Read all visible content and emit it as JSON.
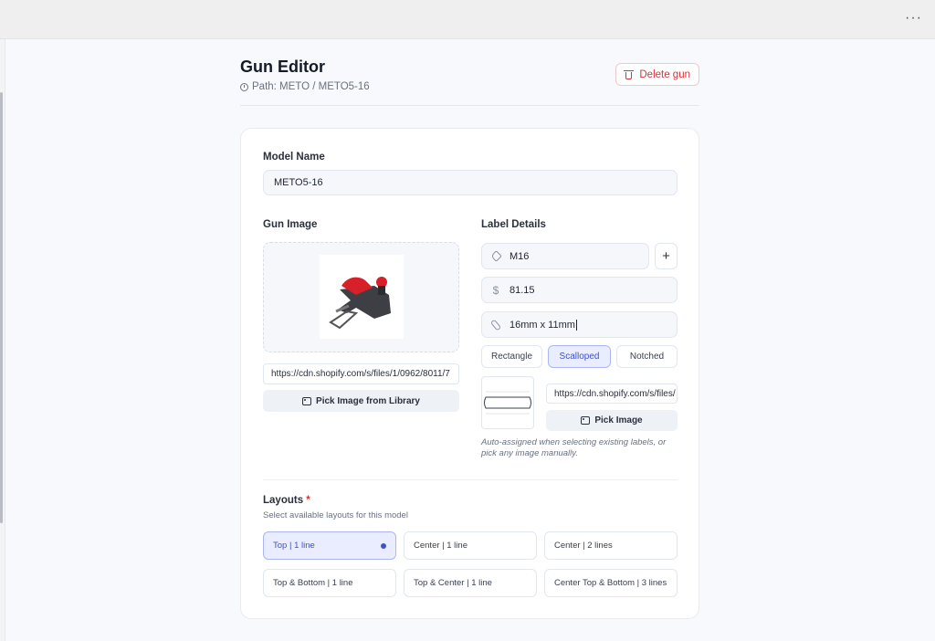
{
  "topbar": {
    "more_label": "···"
  },
  "header": {
    "title": "Gun Editor",
    "path": "Path: METO / METO5-16",
    "delete_label": "Delete gun"
  },
  "form": {
    "model_name_label": "Model Name",
    "model_name_value": "METO5-16",
    "gun_image_label": "Gun Image",
    "gun_image_url": "https://cdn.shopify.com/s/files/1/0962/8011/7",
    "pick_library_label": "Pick Image from Library",
    "label_details_label": "Label Details",
    "label_code": "M16",
    "price_symbol": "$",
    "price_value": "81.15",
    "size_value": "16mm x 11mm",
    "shapes": [
      {
        "label": "Rectangle",
        "active": false
      },
      {
        "label": "Scalloped",
        "active": true
      },
      {
        "label": "Notched",
        "active": false
      }
    ],
    "label_image_url": "https://cdn.shopify.com/s/files/",
    "pick_image_label": "Pick Image",
    "hint": "Auto-assigned when selecting existing labels, or pick any image manually.",
    "layouts_label": "Layouts",
    "required_mark": "*",
    "layouts_sub": "Select available layouts for this model",
    "layouts": [
      {
        "label": "Top | 1 line",
        "active": true
      },
      {
        "label": "Center | 1 line",
        "active": false
      },
      {
        "label": "Center | 2 lines",
        "active": false
      },
      {
        "label": "Top & Bottom | 1 line",
        "active": false
      },
      {
        "label": "Top & Center | 1 line",
        "active": false
      },
      {
        "label": "Center Top & Bottom | 3 lines",
        "active": false
      }
    ]
  },
  "icons": {
    "path": "clock-icon",
    "delete": "trash-icon",
    "label_code": "tag-icon",
    "price": "dollar-icon",
    "size": "paperclip-icon",
    "pick": "image-icon",
    "add": "plus-icon"
  },
  "colors": {
    "accent": "#4251c8",
    "danger": "#d6343a",
    "field_bg": "#f5f7fb"
  }
}
